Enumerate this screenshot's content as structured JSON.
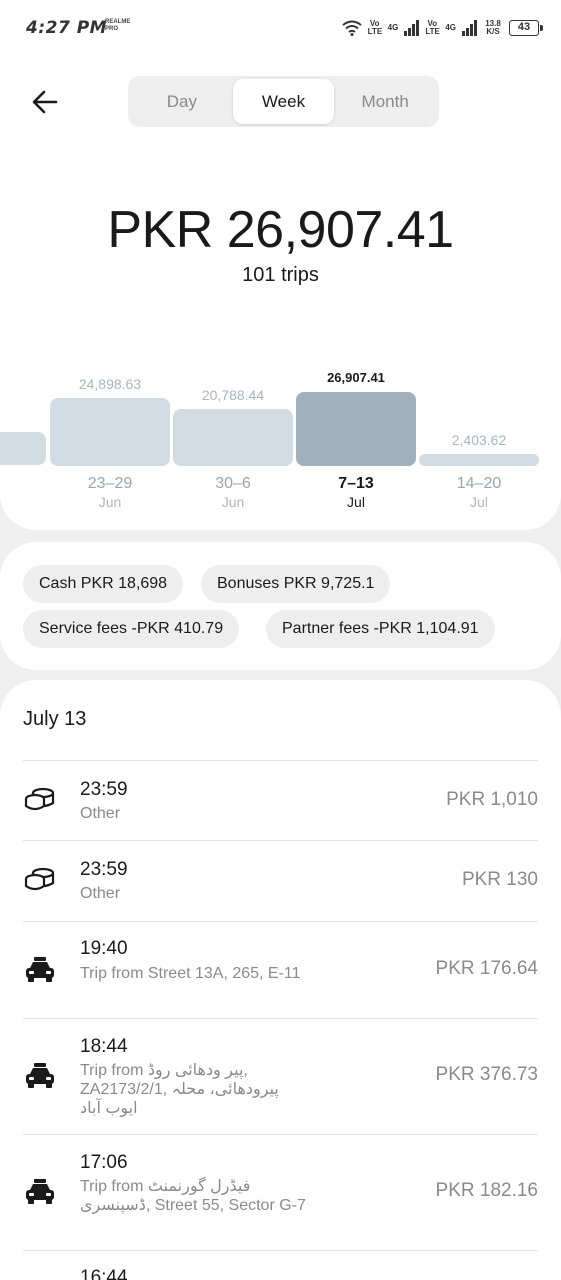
{
  "status_bar": {
    "time": "4:27 PM",
    "brand": "REALME PRO",
    "net1": "Vo LTE",
    "net1_type": "4G",
    "net2": "Vo LTE",
    "net2_type": "4G",
    "speed": "13.8 K/S",
    "battery": "43",
    "icons": [
      "wifi-icon",
      "signal-icon",
      "signal-icon",
      "battery-icon"
    ]
  },
  "header": {
    "back_icon": "arrow-left-icon",
    "tabs": [
      "Day",
      "Week",
      "Month"
    ],
    "active_tab": "Week"
  },
  "summary": {
    "total": "PKR 26,907.41",
    "trips": "101 trips"
  },
  "chart_data": {
    "type": "bar",
    "categories": [
      "23–29 Jun",
      "30–6 Jun",
      "7–13 Jul",
      "14–20 Jul"
    ],
    "values": [
      24898.63,
      20788.44,
      26907.41,
      2403.62
    ],
    "value_labels": [
      "24,898.63",
      "20,788.44",
      "26,907.41",
      "2,403.62"
    ],
    "category_main": [
      "23–29",
      "30–6",
      "7–13",
      "14–20"
    ],
    "category_sub": [
      "Jun",
      "Jun",
      "Jul",
      "Jul"
    ],
    "selected_index": 2,
    "ylim": [
      0,
      26907.41
    ],
    "colors": {
      "bar": "#d4dce3",
      "selected": "#a0b0bd"
    }
  },
  "breakdown": {
    "chips": [
      "Cash PKR 18,698",
      "Bonuses PKR 9,725.1",
      "Service fees -PKR 410.79",
      "Partner fees -PKR 1,104.91"
    ]
  },
  "activity": {
    "date": "July 13",
    "items": [
      {
        "icon": "coins-icon",
        "time": "23:59",
        "desc": "Other",
        "amount": "PKR 1,010"
      },
      {
        "icon": "coins-icon",
        "time": "23:59",
        "desc": "Other",
        "amount": "PKR 130"
      },
      {
        "icon": "car-icon",
        "time": "19:40",
        "desc": "Trip from Street 13A, 265, E-11",
        "amount": "PKR 176.64"
      },
      {
        "icon": "car-icon",
        "time": "18:44",
        "desc": "Trip from پیر ودھائی روڈ, ZA2173/2/1, پیرودھائی، محلہ ایوب آباد",
        "amount": "PKR 376.73"
      },
      {
        "icon": "car-icon",
        "time": "17:06",
        "desc": "Trip from فیڈرل گورنمنٹ ڈسپنسری, Street 55, Sector G-7",
        "amount": "PKR 182.16"
      },
      {
        "icon": "car-icon",
        "time": "16:44",
        "desc": "",
        "amount": ""
      }
    ]
  }
}
